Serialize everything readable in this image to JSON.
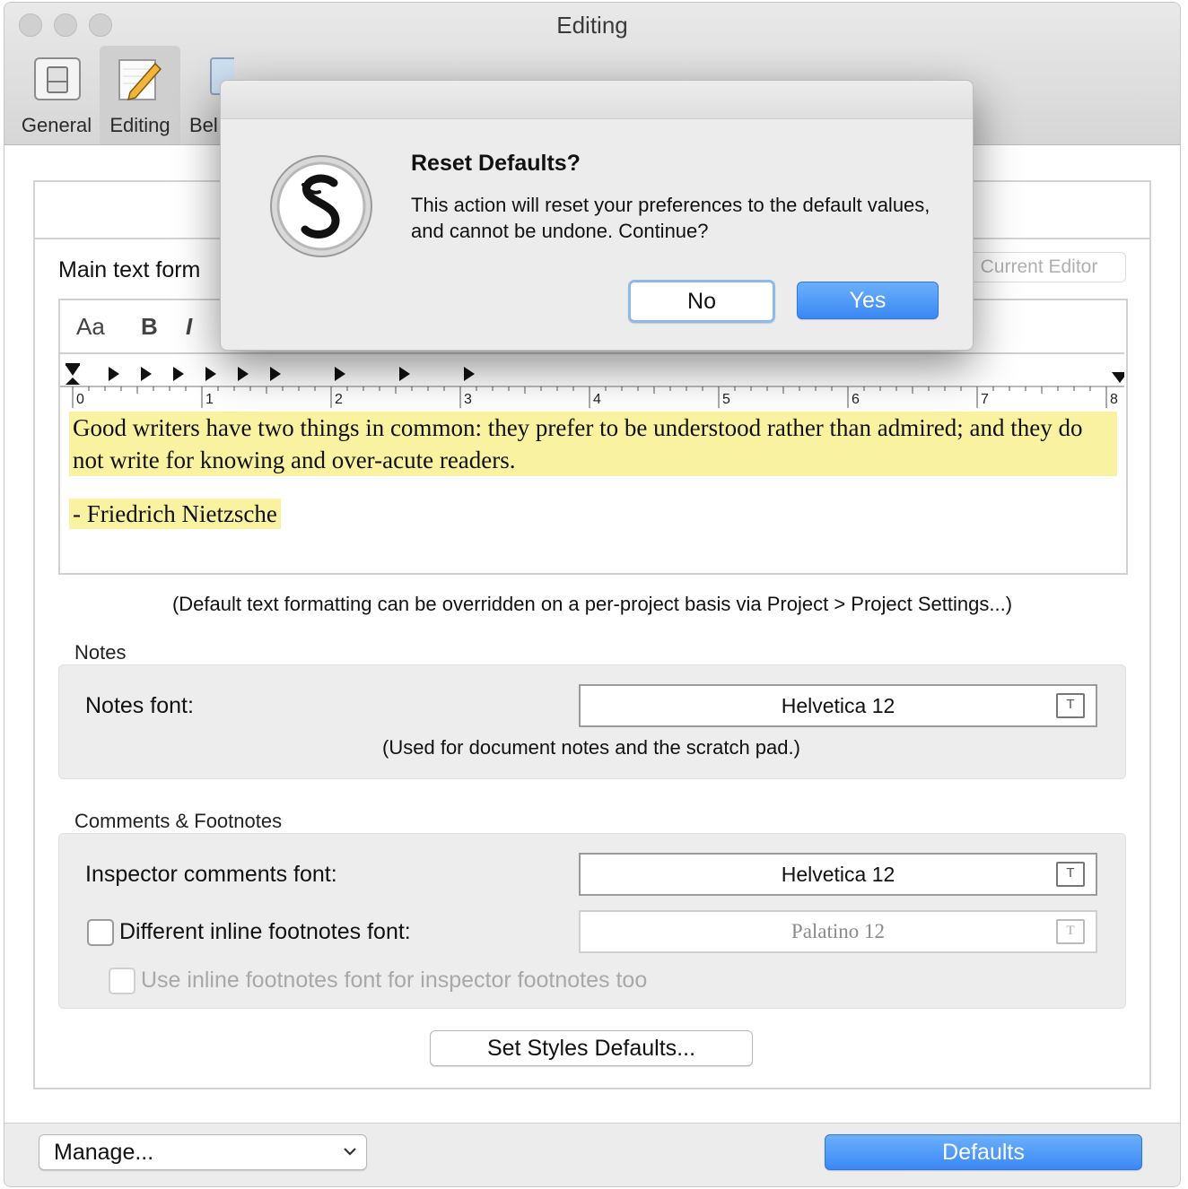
{
  "window": {
    "title": "Editing"
  },
  "toolbar": {
    "items": [
      {
        "label": "General",
        "icon": "general-icon"
      },
      {
        "label": "Editing",
        "icon": "pencil-icon",
        "selected": true
      },
      {
        "label": "Bel",
        "icon": "behaviors-icon"
      }
    ]
  },
  "main": {
    "main_text_label": "Main text form",
    "current_editor_button": "Current Editor",
    "format_bar": {
      "font_button": "Aa",
      "bold_button": "B",
      "italic_button": "I"
    },
    "ruler_labels": [
      "0",
      "1",
      "2",
      "3",
      "4",
      "5",
      "6",
      "7",
      "8"
    ],
    "sample_text": {
      "quote": "Good writers have two things in common: they prefer to be understood rather than admired; and they do not write for knowing and over-acute readers.",
      "attribution": "- Friedrich Nietzsche"
    },
    "hint": "(Default text formatting can be overridden on a per-project basis via Project > Project Settings...)"
  },
  "notes": {
    "section_title": "Notes",
    "font_label": "Notes font:",
    "font_value": "Helvetica 12",
    "hint": "(Used for document notes and the scratch pad.)"
  },
  "comments": {
    "section_title": "Comments & Footnotes",
    "inspector_label": "Inspector comments font:",
    "inspector_value": "Helvetica 12",
    "inline_label": "Different inline footnotes font:",
    "inline_value": "Palatino 12",
    "inline_checked": false,
    "inspector_footnotes_label": "Use inline footnotes font for inspector footnotes too",
    "inspector_footnotes_checked": false
  },
  "buttons": {
    "set_styles": "Set Styles Defaults...",
    "manage": "Manage...",
    "defaults": "Defaults"
  },
  "dialog": {
    "title": "Reset Defaults?",
    "message": "This action will reset your preferences to the default values, and cannot be undone. Continue?",
    "no_label": "No",
    "yes_label": "Yes",
    "accent_color": "#3a88f4"
  }
}
